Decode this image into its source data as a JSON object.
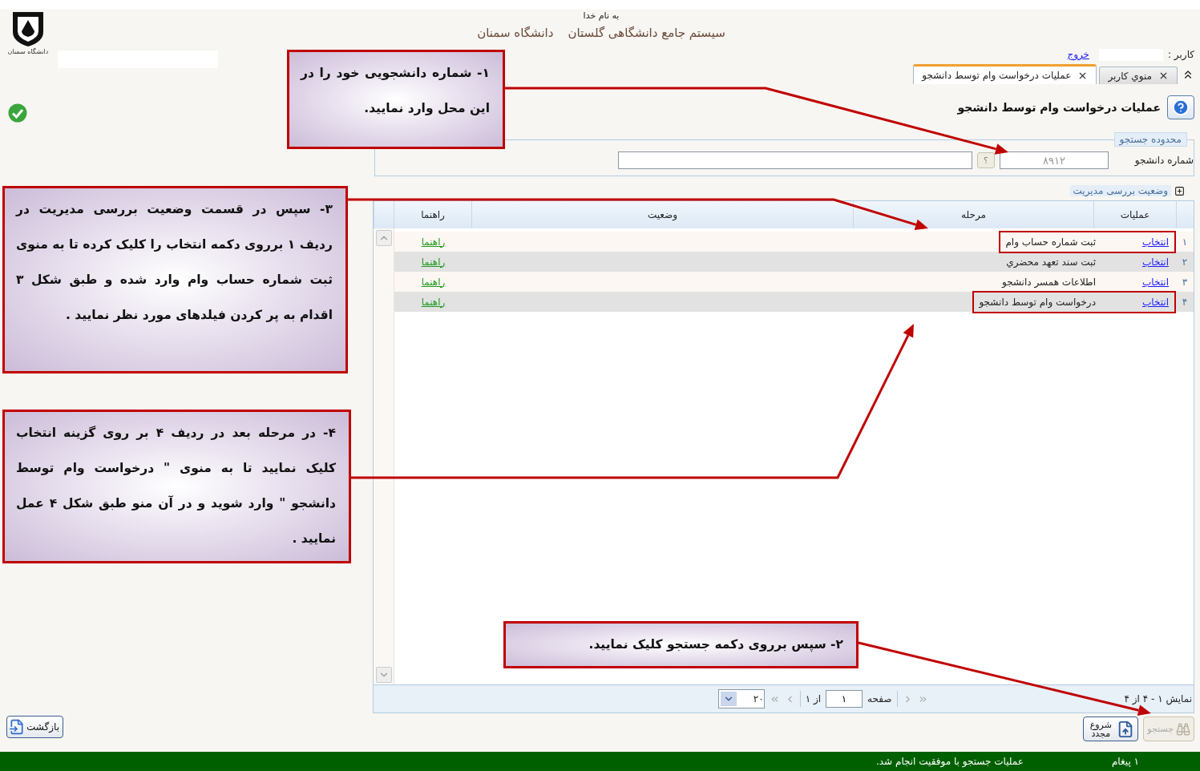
{
  "logo": {
    "caption": "دانشگاه سمنان"
  },
  "header": {
    "greeting": "به نام خدا",
    "system_name": "سیستم جامع دانشگاهی گلستان",
    "university": "دانشگاه سمنان"
  },
  "user_bar": {
    "user_label": "کاربر :",
    "logout": "خروج"
  },
  "tabs": [
    {
      "label": "منوي کاربر",
      "selected": false
    },
    {
      "label": "عملیات درخواست وام توسط دانشجو",
      "selected": true
    }
  ],
  "page_title": "عملیات درخواست وام توسط دانشجو",
  "search": {
    "legend": "محدوده جستجو",
    "student_number_label": "شماره دانشجو",
    "student_number_placeholder": "۸۹۱۲",
    "help_button": "؟"
  },
  "status_section": {
    "label": "وضعیت بررسی مدیریت",
    "expanded": false
  },
  "table": {
    "columns": [
      "عملیات",
      "مرحله",
      "وضعیت",
      "راهنما"
    ],
    "rows": [
      {
        "index": "۱",
        "action": "انتخاب",
        "stage": "ثبت شماره حساب وام",
        "guide": "راهنما",
        "highlighted": true
      },
      {
        "index": "۲",
        "action": "انتخاب",
        "stage": "ثبت سند تعهد محضري",
        "guide": "راهنما",
        "highlighted": false
      },
      {
        "index": "۳",
        "action": "انتخاب",
        "stage": "اطلاعات همسر دانشجو",
        "guide": "راهنما",
        "highlighted": false
      },
      {
        "index": "۴",
        "action": "انتخاب",
        "stage": "درخواست وام توسط دانشجو",
        "guide": "راهنما",
        "highlighted": true
      }
    ]
  },
  "pager": {
    "summary": "نمایش ۱ - ۴ از ۴",
    "page_label": "صفحه",
    "page": "۱",
    "of_pages": "از ۱",
    "page_size": "۲۰"
  },
  "buttons": [
    {
      "kind": "search",
      "label": "جستجو",
      "disabled": true
    },
    {
      "kind": "reset",
      "label": "شروع مجدد",
      "disabled": false
    }
  ],
  "back_button": "بازگشت",
  "status_bar": {
    "count": "۱ پیغام",
    "message": "عملیات جستجو با موفقیت انجام شد."
  },
  "callouts": [
    {
      "text": "۱- شماره دانشجویی خود را در این محل وارد نمایید."
    },
    {
      "text": "۳- سپس  در قسمت وضعیت بررسی مدیریت در ردیف ۱ برروی دکمه انتخاب را کلیک کرده تا به منوی ثبت شماره حساب وام وارد شده و طبق شکل ۳ اقدام به پر کردن فیلدهای مورد نظر نمایید ."
    },
    {
      "text": "۴- در مرحله بعد در ردیف ۴ بر روی گزینه انتخاب کلیک نمایید تا به منوی \" درخواست وام توسط دانشجو \" وارد شوید و در آن منو طبق شکل ۴ عمل نمایید ."
    },
    {
      "text": "۲- سپس  برروی دکمه جستجو کلیک نمایید."
    }
  ]
}
